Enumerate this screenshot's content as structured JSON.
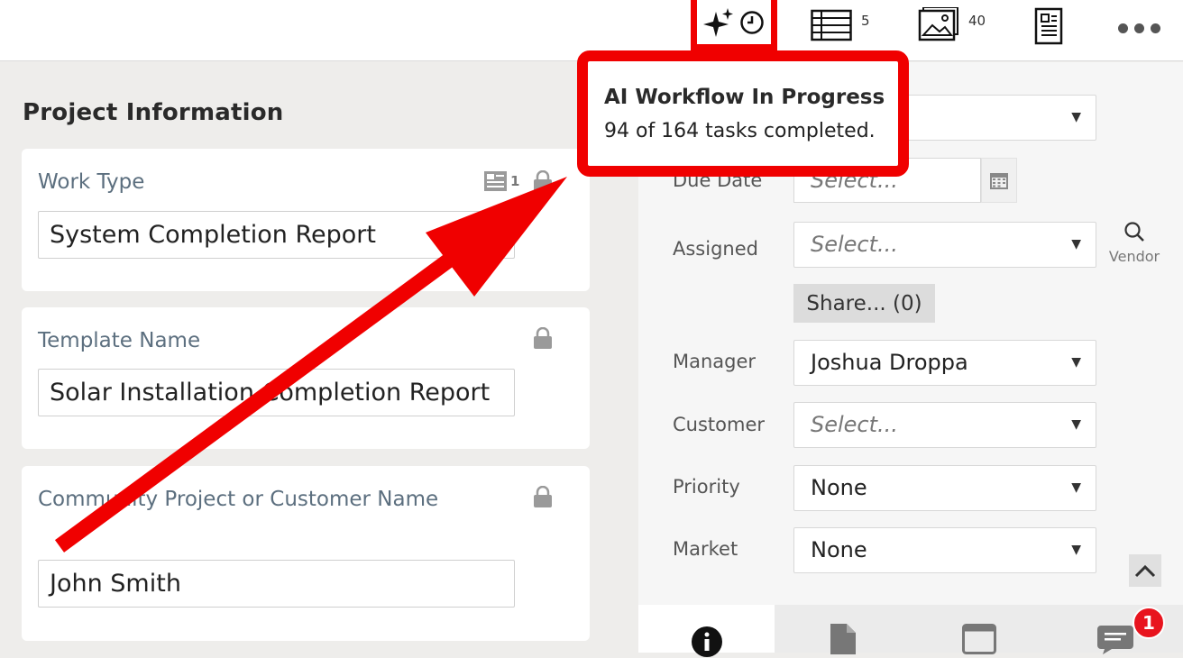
{
  "toolbar": {
    "ai_icon": "sparkle-clock-icon",
    "table_count": "5",
    "gallery_count": "40",
    "document_icon": "document-icon",
    "more_icon": "more-horizontal-icon"
  },
  "tooltip": {
    "title": "AI Workflow In Progress",
    "body": "94 of 164 tasks completed."
  },
  "project": {
    "section_title": "Project Information",
    "work_type": {
      "label": "Work Type",
      "value": "System Completion Report",
      "badge_count": "1"
    },
    "template_name": {
      "label": "Template Name",
      "value": "Solar Installation Completion Report"
    },
    "customer_name": {
      "label": "Community Project or Customer Name",
      "value": "John Smith"
    }
  },
  "details": {
    "due_date": {
      "label": "Due Date",
      "placeholder": "Select..."
    },
    "assigned": {
      "label": "Assigned",
      "value": "Select..."
    },
    "vendor_label": "Vendor",
    "share_label": "Share... (0)",
    "manager": {
      "label": "Manager",
      "value": "Joshua Droppa"
    },
    "customer": {
      "label": "Customer",
      "value": "Select..."
    },
    "priority": {
      "label": "Priority",
      "value": "None"
    },
    "market": {
      "label": "Market",
      "value": "None"
    }
  },
  "bottom_tabs": [
    {
      "icon": "info-icon"
    },
    {
      "icon": "file-icon"
    },
    {
      "icon": "window-icon"
    },
    {
      "icon": "chat-icon",
      "badge": "1"
    }
  ],
  "colors": {
    "highlight": "#f00000",
    "label": "#5c6f7f",
    "badge": "#e8141e"
  }
}
